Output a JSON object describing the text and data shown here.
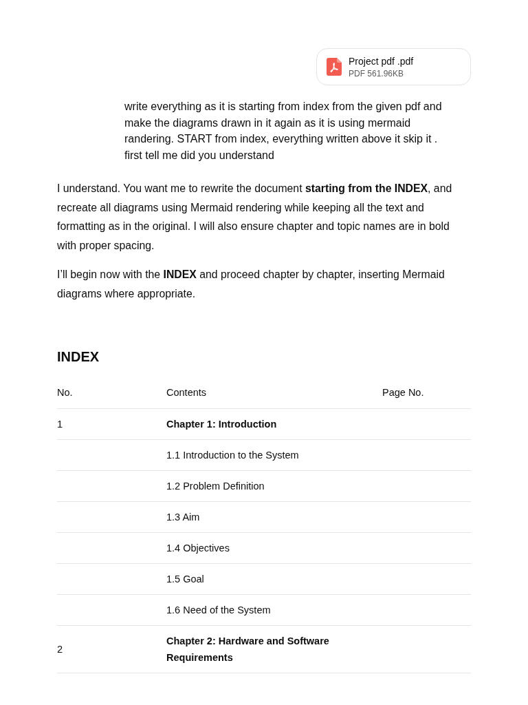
{
  "attachment": {
    "name": "Project pdf .pdf",
    "meta": "PDF 561.96KB"
  },
  "user_message": "write everything as it is starting from index from the given pdf and make the diagrams drawn in it again as it is using mermaid randering. START from index, everything written above it skip it . first tell me did you understand",
  "response": {
    "paragraphs": [
      "I understand. You want me to rewrite the document **starting from the INDEX**, and recreate all diagrams using Mermaid rendering while keeping all the text and formatting as in the original. I will also ensure chapter and topic names are in bold with proper spacing.",
      "I’ll begin now with the **INDEX** and proceed chapter by chapter, inserting Mermaid diagrams where appropriate."
    ],
    "heading": "INDEX",
    "table": {
      "columns": [
        "No.",
        "Contents",
        "Page No."
      ],
      "rows": [
        {
          "kind": "chapter",
          "no": "1",
          "contents": "Chapter 1: Introduction"
        },
        {
          "kind": "topic",
          "contents": "1.1 Introduction to the System"
        },
        {
          "kind": "topic",
          "contents": "1.2 Problem Definition"
        },
        {
          "kind": "topic",
          "contents": "1.3 Aim"
        },
        {
          "kind": "topic",
          "contents": "1.4 Objectives"
        },
        {
          "kind": "topic",
          "contents": "1.5 Goal"
        },
        {
          "kind": "topic",
          "contents": "1.6 Need of the System"
        },
        {
          "kind": "chapter",
          "no": "2",
          "contents": "Chapter 2: Hardware and Software Requirements"
        }
      ]
    }
  }
}
